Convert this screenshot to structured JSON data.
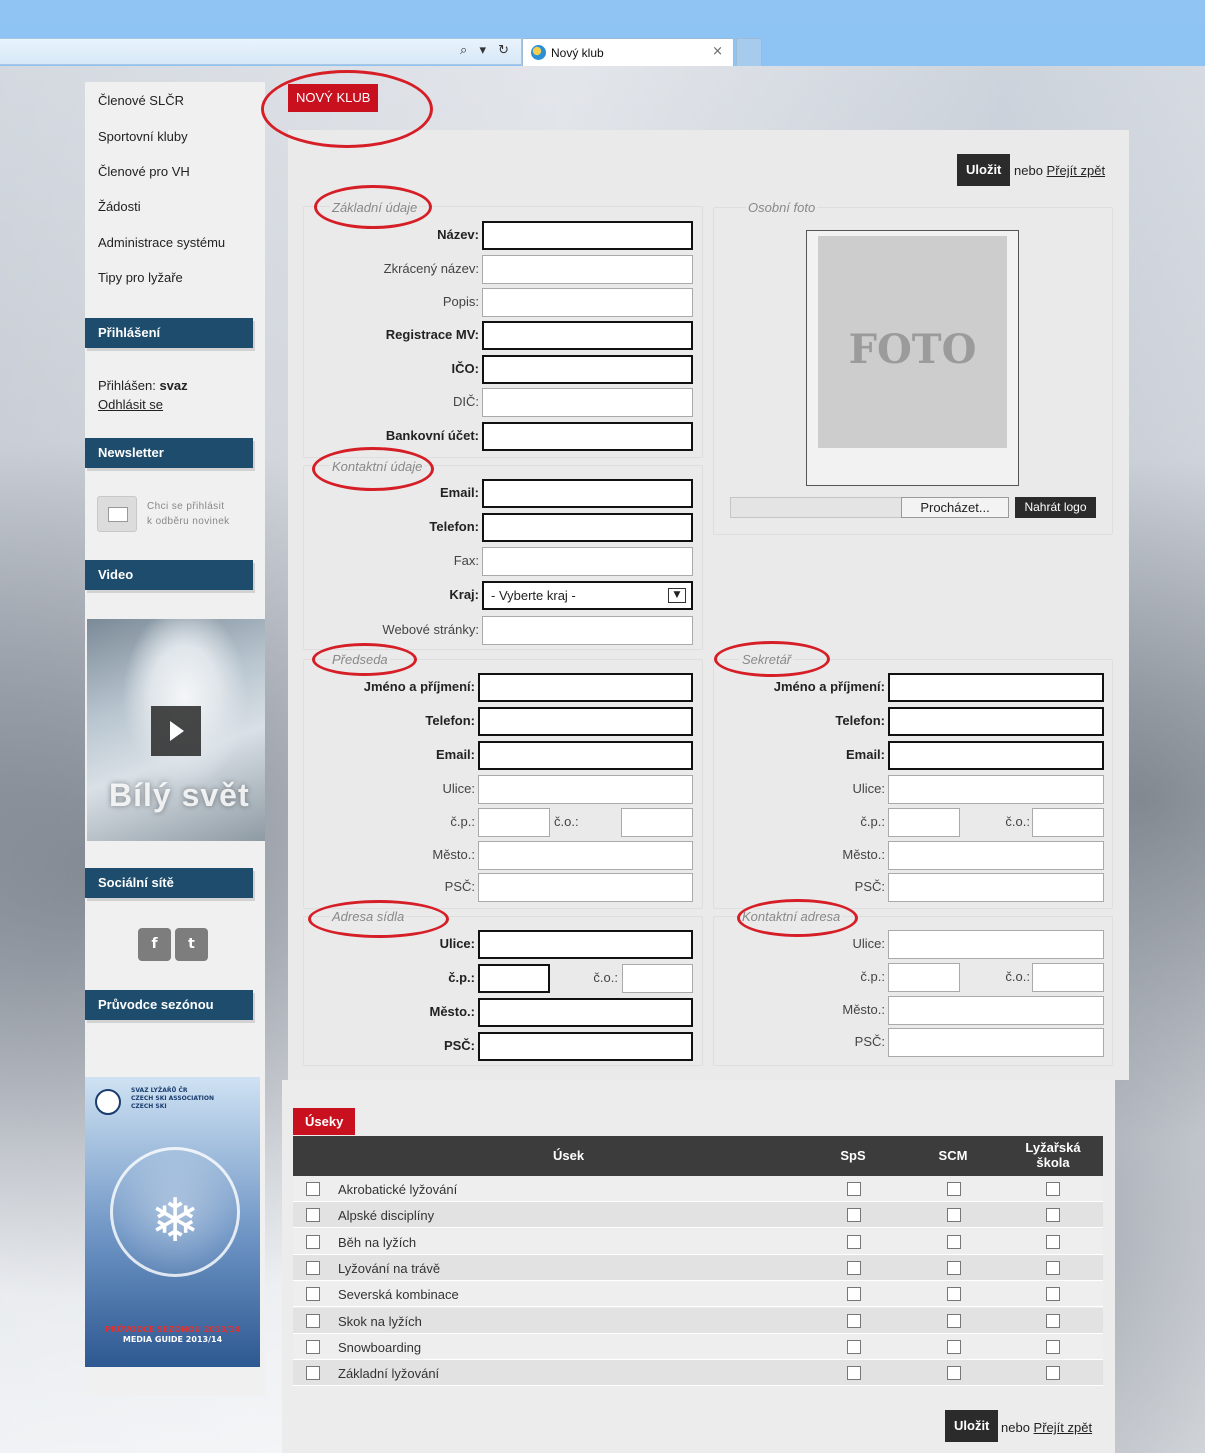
{
  "browser": {
    "tab_title": "Nový klub",
    "tab_close": "×",
    "addr_icons": "⌕ ▾ ↻"
  },
  "sidebar": {
    "nav": [
      "Členové SLČR",
      "Sportovní kluby",
      "Členové pro VH",
      "Žádosti",
      "Administrace systému",
      "Tipy pro lyžaře"
    ],
    "login_heading": "Přihlášení",
    "logged_in_label": "Přihlášen:",
    "logged_in_user": "svaz",
    "logout": "Odhlásit se",
    "newsletter_heading": "Newsletter",
    "newsletter_text_1": "Chci se přihlásit",
    "newsletter_text_2": "k odběru novinek",
    "video_heading": "Video",
    "video_caption": "Bílý svět",
    "social_heading": "Sociální sítě",
    "social_icons": [
      "f",
      "t"
    ],
    "guide_heading": "Průvodce sezónou",
    "guide_brand_1": "SVAZ LYŽAŘŮ ČR",
    "guide_brand_2": "CZECH SKI ASSOCIATION",
    "guide_brand_3": "CZECH SKI",
    "guide_title_1": "PRŮVODCE SEZÓNOU 2013/14",
    "guide_title_2": "MEDIA GUIDE 2013/14"
  },
  "page": {
    "title": "NOVÝ KLUB",
    "save": "Uložit",
    "or": "nebo",
    "back": "Přejít zpět"
  },
  "basic": {
    "legend": "Základní údaje",
    "fields": [
      {
        "label": "Název:",
        "value": ""
      },
      {
        "label": "Zkrácený název:",
        "value": ""
      },
      {
        "label": "Popis:",
        "value": ""
      },
      {
        "label": "Registrace MV:",
        "value": ""
      },
      {
        "label": "IČO:",
        "value": ""
      },
      {
        "label": "DIČ:",
        "value": ""
      },
      {
        "label": "Bankovní účet:",
        "value": ""
      }
    ]
  },
  "photo": {
    "legend": "Osobní foto",
    "placeholder": "FOTO",
    "browse": "Procházet...",
    "upload": "Nahrát logo"
  },
  "contact": {
    "legend": "Kontaktní údaje",
    "fields": [
      {
        "label": "Email:"
      },
      {
        "label": "Telefon:"
      },
      {
        "label": "Fax:"
      },
      {
        "label": "Kraj:"
      },
      {
        "label": "Webové stránky:"
      }
    ],
    "region_selected": "- Vyberte kraj -"
  },
  "chairman": {
    "legend": "Předseda",
    "labels": [
      "Jméno a příjmení:",
      "Telefon:",
      "Email:",
      "Ulice:",
      "č.p.:",
      "č.o.:",
      "Město.:",
      "PSČ:"
    ]
  },
  "secretary": {
    "legend": "Sekretář",
    "labels": [
      "Jméno a příjmení:",
      "Telefon:",
      "Email:",
      "Ulice:",
      "č.p.:",
      "č.o.:",
      "Město.:",
      "PSČ:"
    ]
  },
  "hq_address": {
    "legend": "Adresa sídla",
    "labels": [
      "Ulice:",
      "č.p.:",
      "č.o.:",
      "Město.:",
      "PSČ:"
    ]
  },
  "contact_address": {
    "legend": "Kontaktní adresa",
    "labels": [
      "Ulice:",
      "č.p.:",
      "č.o.:",
      "Město.:",
      "PSČ:"
    ]
  },
  "sections": {
    "badge": "Úseky",
    "headers": {
      "name": "Úsek",
      "sps": "SpS",
      "scm": "SCM",
      "school_1": "Lyžařská",
      "school_2": "škola"
    },
    "rows": [
      "Akrobatické lyžování",
      "Alpské disciplíny",
      "Běh na lyžích",
      "Lyžování na trávě",
      "Severská kombinace",
      "Skok na lyžích",
      "Snowboarding",
      "Základní lyžování"
    ]
  },
  "colors": {
    "accent_red": "#c8101f",
    "sidebar_head": "#1d4c6d",
    "dark_button": "#2b2b2b"
  }
}
